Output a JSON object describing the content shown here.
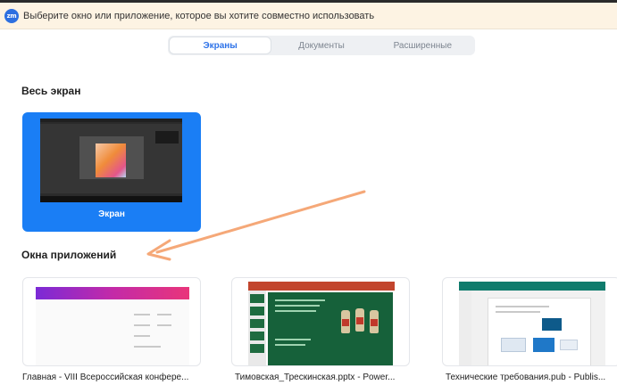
{
  "window": {
    "title": "Выберите окно или приложение, которое вы хотите совместно использовать",
    "app_icon_text": "zm"
  },
  "tabs": [
    {
      "label": "Экраны",
      "active": true
    },
    {
      "label": "Документы",
      "active": false
    },
    {
      "label": "Расширенные",
      "active": false
    }
  ],
  "sections": {
    "full_screen": "Весь экран",
    "app_windows": "Окна приложений"
  },
  "screens": [
    {
      "label": "Экран",
      "selected": true
    }
  ],
  "apps": [
    {
      "label": "Главная - VIII Всероссийская конфере...",
      "type": "browser"
    },
    {
      "label": "Тимовская_Трескинская.pptx - Power...",
      "type": "powerpoint"
    },
    {
      "label": "Технические требования.pub - Publis...",
      "type": "publisher"
    }
  ],
  "colors": {
    "accent": "#1a7ef5",
    "title_bar_bg": "#fdf3e3",
    "annotation_arrow": "#f5a878"
  }
}
